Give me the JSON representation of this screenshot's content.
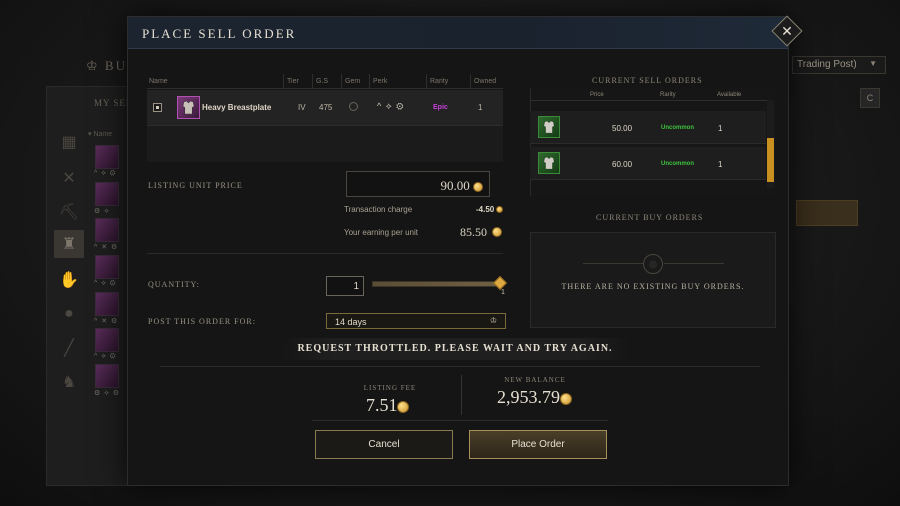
{
  "background": {
    "header_partial": "BUY",
    "panel_title_partial": "MY SEL",
    "name_column": "Name",
    "dropdown_partial": "Trading Post)",
    "button_c": "C",
    "categories": [
      "grid-icon",
      "tools-icon",
      "pickaxe-icon",
      "armor-icon",
      "gloves-icon",
      "bag-icon",
      "rod-icon",
      "chair-icon"
    ]
  },
  "modal": {
    "title": "PLACE SELL ORDER",
    "close_glyph": "✕"
  },
  "item_table": {
    "columns": [
      "Name",
      "Tier",
      "G.S",
      "Gem",
      "Perk",
      "Rarity",
      "Owned"
    ],
    "row": {
      "name": "Heavy Breastplate",
      "tier": "IV",
      "gear_score": "475",
      "perks": "^ ⟡ ⚙",
      "rarity": "Epic",
      "owned": "1"
    }
  },
  "listing": {
    "unit_price_label": "LISTING UNIT PRICE",
    "unit_price": "90.00",
    "transaction_charge_label": "Transaction charge",
    "transaction_charge": "-4.50",
    "earning_label": "Your earning per unit",
    "earning": "85.50"
  },
  "quantity": {
    "label": "QUANTITY:",
    "value": "1",
    "max": "1",
    "slider_fraction": 1.0
  },
  "duration": {
    "label": "POST THIS ORDER FOR:",
    "value": "14 days"
  },
  "sell_orders": {
    "title": "CURRENT SELL ORDERS",
    "columns": [
      "Price",
      "Rarity",
      "Available"
    ],
    "rows": [
      {
        "price": "50.00",
        "rarity": "Uncommon",
        "available": "1"
      },
      {
        "price": "60.00",
        "rarity": "Uncommon",
        "available": "1"
      }
    ]
  },
  "buy_orders": {
    "title": "CURRENT BUY ORDERS",
    "empty": "THERE ARE NO EXISTING BUY ORDERS."
  },
  "banner": "REQUEST THROTTLED. PLEASE WAIT AND TRY AGAIN.",
  "footer": {
    "fee_label": "LISTING FEE",
    "fee": "7.51",
    "balance_label": "NEW BALANCE",
    "balance": "2,953.79",
    "cancel": "Cancel",
    "place": "Place Order"
  },
  "colors": {
    "epic": "#c242d6",
    "uncommon": "#3ec23e",
    "gold": "#c89020"
  }
}
